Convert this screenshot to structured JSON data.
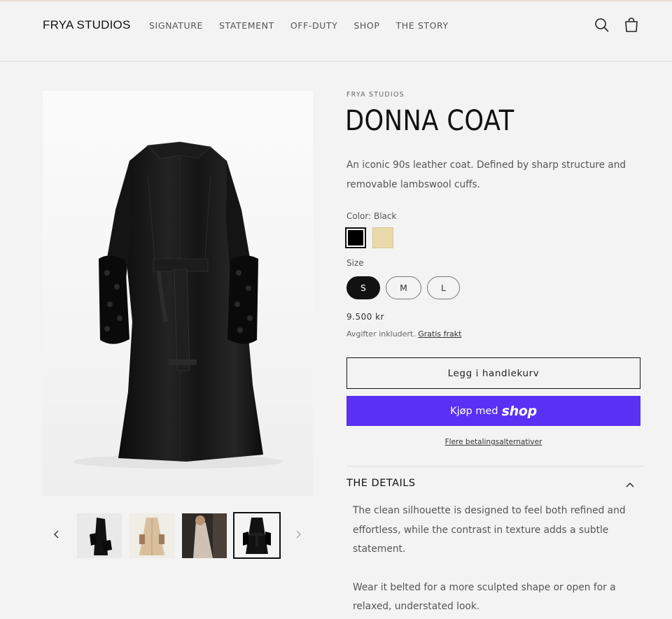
{
  "brand": {
    "logo": "FRYA STUDIOS"
  },
  "nav": {
    "items": [
      "SIGNATURE",
      "STATEMENT",
      "OFF-DUTY",
      "SHOP",
      "THE STORY"
    ]
  },
  "header_icons": [
    "search-icon",
    "cart-icon"
  ],
  "product": {
    "vendor": "FRYA STUDIOS",
    "title": "DONNA COAT",
    "description": "An iconic 90s leather coat. Defined by sharp structure and removable lambswool cuffs.",
    "color_label": "Color: Black",
    "colors": [
      {
        "name": "Black",
        "hex": "#000000",
        "selected": true
      },
      {
        "name": "Beige",
        "hex": "#ead9aa",
        "selected": false
      }
    ],
    "size_label": "Size",
    "sizes": [
      {
        "label": "S",
        "selected": true
      },
      {
        "label": "M",
        "selected": false
      },
      {
        "label": "L",
        "selected": false
      }
    ],
    "price": "9.500 kr",
    "tax_text": "Avgifter inkludert.",
    "shipping_link": "Gratis frakt",
    "add_to_cart": "Legg i handlekurv",
    "shop_pay": {
      "prefix": "Kjøp med",
      "brand": "shop",
      "color": "#5a31f4"
    },
    "more_payment": "Flere betalingsalternativer",
    "details": {
      "heading": "THE DETAILS",
      "paragraphs": [
        "The clean silhouette is designed to feel both refined and effortless, while the contrast in texture adds a subtle statement.",
        "Wear it belted for a more sculpted shape or open for a relaxed, understated look."
      ]
    }
  },
  "gallery": {
    "thumbnails": [
      {
        "name": "black coat side view",
        "active": false
      },
      {
        "name": "beige coat front view",
        "active": false
      },
      {
        "name": "beige coat model photo",
        "active": false
      },
      {
        "name": "black coat back view",
        "active": true
      }
    ]
  }
}
